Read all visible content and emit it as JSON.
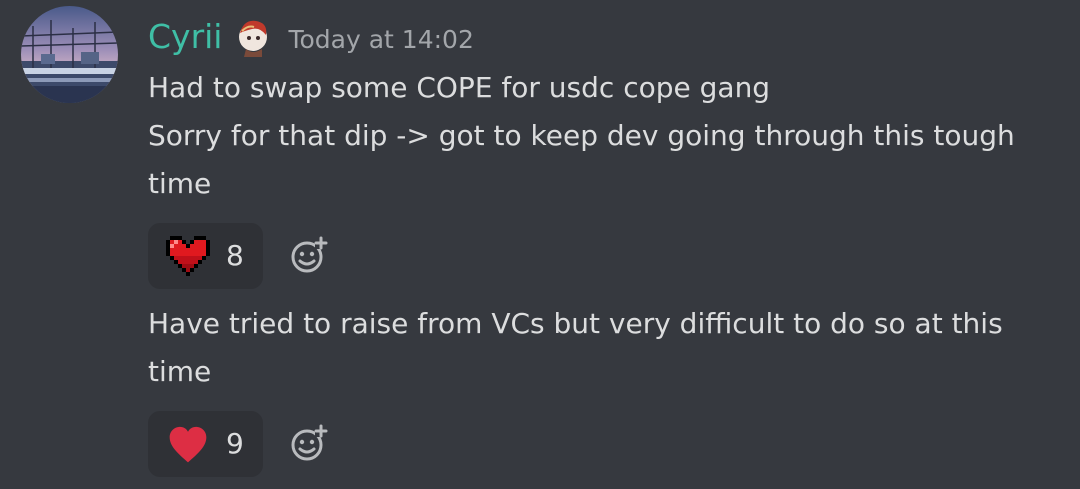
{
  "author": {
    "username": "Cyrii",
    "username_color": "#3fbfa6",
    "avatar_icon": "anime-landscape-avatar",
    "role_icon": "character-emoji-icon",
    "timestamp": "Today at 14:02"
  },
  "messages": [
    {
      "lines": [
        "Had to swap some COPE for usdc cope gang",
        "Sorry for that dip -> got to keep dev going through this tough",
        "time"
      ],
      "reaction": {
        "emoji": "pixel-heart-icon",
        "count": "8"
      }
    },
    {
      "lines": [
        "Have tried to raise from VCs but very difficult to do so at this",
        "time"
      ],
      "reaction": {
        "emoji": "red-heart-icon",
        "count": "9"
      }
    }
  ],
  "colors": {
    "background": "#36393f",
    "reaction_bg": "#2f3136",
    "text": "#dcddde",
    "timestamp": "#a3a6aa",
    "heart": "#dd2e44"
  }
}
